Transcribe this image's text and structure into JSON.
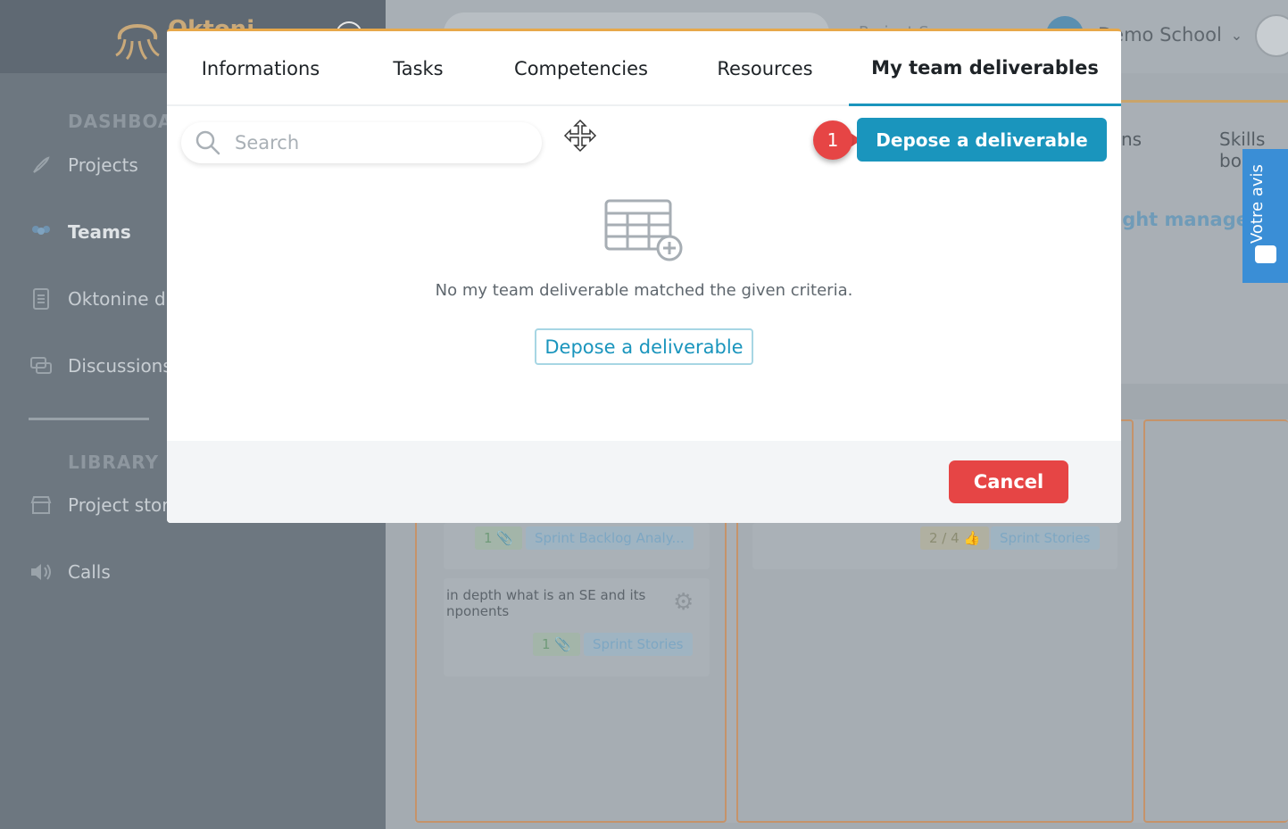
{
  "background": {
    "logo_text": "Oktoni",
    "sidebar": {
      "section_dashboard": "DASHBOARD",
      "section_library": "LIBRARY",
      "items": [
        {
          "label": "Projects",
          "icon": "rocket-icon"
        },
        {
          "label": "Teams",
          "icon": "team-icon"
        },
        {
          "label": "Oktonine drive",
          "icon": "document-icon"
        },
        {
          "label": "Discussions",
          "icon": "chat-icon"
        },
        {
          "label": "Project store",
          "icon": "store-icon"
        },
        {
          "label": "Calls",
          "icon": "speaker-icon"
        }
      ]
    },
    "topbar": {
      "mid_text": "Project Space",
      "school_name": "Demo School"
    },
    "panel": {
      "tab_partial_1": "ns",
      "tab_partial_2": "Skills board",
      "link_text": "ight manager",
      "card1_attach_count": "1",
      "card1_tag": "Sprint Backlog Analy...",
      "card2_text": "in depth what is an SE and its\nnponents",
      "card2_attach_count": "1",
      "card2_tag": "Sprint Stories",
      "card3_likes": "2 / 4",
      "card3_tag": "Sprint Stories"
    },
    "feedback_label": "Votre avis"
  },
  "modal": {
    "tabs": [
      {
        "label": "Informations",
        "active": false
      },
      {
        "label": "Tasks",
        "active": false
      },
      {
        "label": "Competencies",
        "active": false
      },
      {
        "label": "Resources",
        "active": false
      },
      {
        "label": "My team deliverables",
        "active": true
      }
    ],
    "search_placeholder": "Search",
    "primary_button": "Depose a deliverable",
    "step_number": "1",
    "empty_message": "No my team deliverable matched the given criteria.",
    "empty_button": "Depose a deliverable",
    "cancel_button": "Cancel"
  },
  "colors": {
    "accent": "#1a95bd",
    "danger": "#e64545",
    "modal_border": "#e7a84a"
  }
}
